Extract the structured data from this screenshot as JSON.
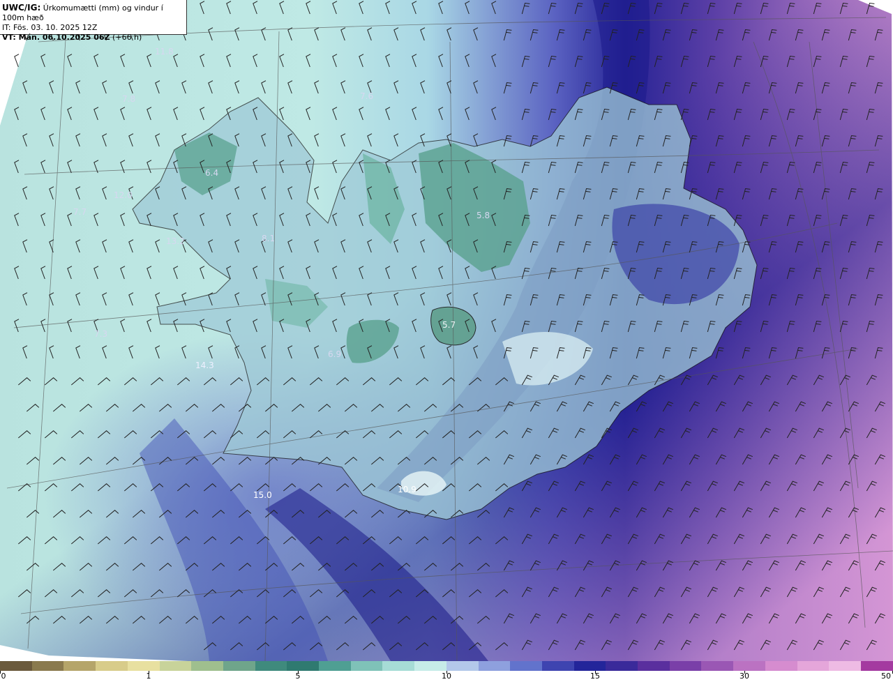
{
  "header": {
    "model": "UWC/IG:",
    "title": " Úrkomumætti (mm) og vindur í 100m hæð",
    "it_line": "IT: Fös. 03. 10. 2025 12Z",
    "vt_label": "VT: Mán. 06.10.2025 06Z",
    "vt_lead": " (+66 h)"
  },
  "colors": {
    "ocean_light": "#b8e6e2",
    "teal_mid": "#6fb7a6",
    "teal_dark": "#4e9a87",
    "blue_mid": "#5f6fc8",
    "navy": "#1b1a8f",
    "purple": "#7b4fb8",
    "pink": "#d99ad4",
    "outside": "#ffffff"
  },
  "map_labels": [
    {
      "text": "11.8"
    },
    {
      "text": "7.8"
    },
    {
      "text": "12.0"
    },
    {
      "text": "7.7"
    },
    {
      "text": "6.4"
    },
    {
      "text": "13.2"
    },
    {
      "text": "8.1"
    },
    {
      "text": "7.6"
    },
    {
      "text": "5.8"
    },
    {
      "text": "5.7"
    },
    {
      "text": "6.9"
    },
    {
      "text": "7.3"
    },
    {
      "text": "14.3"
    },
    {
      "text": "15.0"
    },
    {
      "text": "10.9"
    }
  ],
  "colorbar": {
    "ticks": [
      "0",
      "1",
      "5",
      "10",
      "15",
      "30",
      "50"
    ],
    "segments": [
      "#6b5a3c",
      "#8a7a4e",
      "#b5a56a",
      "#d8cc8a",
      "#e8e0a0",
      "#c8d39a",
      "#9fbf8e",
      "#6fa58b",
      "#3f8a7d",
      "#2f7a70",
      "#4f9f93",
      "#7fc2b8",
      "#a6dcd6",
      "#c6ece8",
      "#b3c8ea",
      "#8ea0de",
      "#6273cc",
      "#3e44b0",
      "#23259a",
      "#3a2a9a",
      "#5a2f9e",
      "#7a3fa8",
      "#9a57b4",
      "#bb72c2",
      "#d68ccf",
      "#e5a6da",
      "#eebbe4",
      "#a43aa0"
    ]
  }
}
